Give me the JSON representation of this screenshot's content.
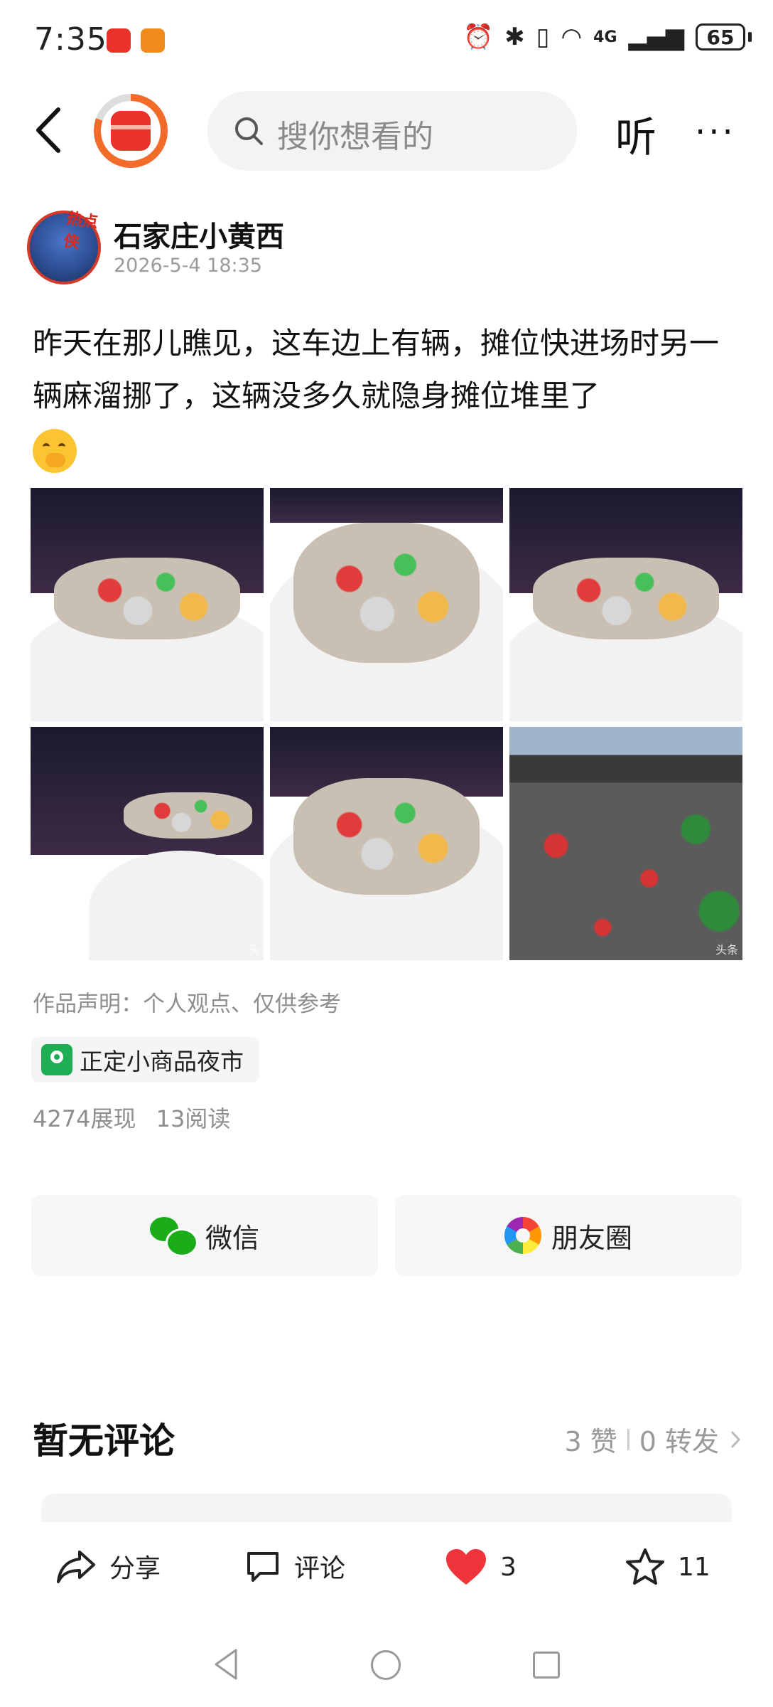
{
  "status_bar": {
    "time": "7:35",
    "network": "4G",
    "battery": "65",
    "icons": [
      "alarm-icon",
      "bluetooth-icon",
      "vibrate-icon",
      "wifi-icon",
      "signal-icon"
    ]
  },
  "top_nav": {
    "search_placeholder": "搜你想看的",
    "listen_label": "听",
    "more_label": "···"
  },
  "post": {
    "author": "石家庄小黄西",
    "avatar_badge": "热点侠",
    "date": "2026-5-4 18:35",
    "text": "昨天在那儿瞧见，这车边上有辆，摊位快进场时另一辆麻溜挪了，这辆没多久就隐身摊位堆里了",
    "images": [
      {
        "name": "photo-1",
        "watermark": ""
      },
      {
        "name": "photo-2",
        "watermark": ""
      },
      {
        "name": "photo-3",
        "watermark": ""
      },
      {
        "name": "photo-4",
        "watermark": "头"
      },
      {
        "name": "photo-5",
        "watermark": ""
      },
      {
        "name": "photo-6",
        "watermark": "头条"
      }
    ],
    "disclaimer": "作品声明：个人观点、仅供参考",
    "location": "正定小商品夜市",
    "views": "4274展现",
    "reads": "13阅读"
  },
  "share": {
    "wechat_label": "微信",
    "moments_label": "朋友圈"
  },
  "comments": {
    "title": "暂无评论",
    "likes": "3 赞",
    "reposts": "0 转发"
  },
  "bottom_bar": {
    "share_label": "分享",
    "comment_label": "评论",
    "like_count": "3",
    "favorite_count": "11"
  },
  "colors": {
    "accent_red": "#e8322a",
    "like_red": "#f0343b",
    "wechat_green": "#1aad19"
  }
}
